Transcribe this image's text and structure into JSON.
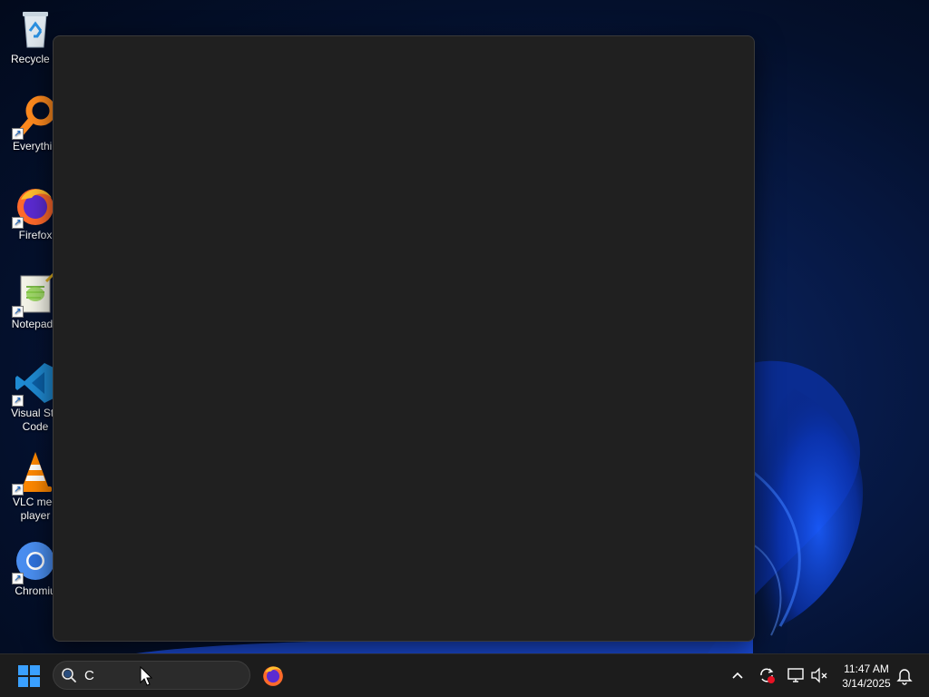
{
  "desktop": {
    "icons": [
      {
        "label": "Recycle B",
        "icon": "recycle-bin-icon"
      },
      {
        "label": "Everythin",
        "icon": "everything-search-icon"
      },
      {
        "label": "Firefox",
        "icon": "firefox-icon"
      },
      {
        "label": "Notepad+",
        "icon": "notepad-plus-plus-icon"
      },
      {
        "label": "Visual Stu\nCode",
        "icon": "vscode-icon"
      },
      {
        "label": "VLC med\nplayer",
        "icon": "vlc-icon"
      },
      {
        "label": "Chromiu",
        "icon": "chromium-icon"
      }
    ]
  },
  "taskbar": {
    "start_icon": "windows-start-icon",
    "search": {
      "value": "C",
      "icon": "search-icon"
    },
    "pinned": [
      {
        "name": "Firefox",
        "icon": "firefox-icon"
      }
    ],
    "tray": {
      "chevron_icon": "chevron-up-icon",
      "sync_icon": "sync-alert-icon",
      "network_icon": "network-icon",
      "volume_icon": "volume-muted-icon",
      "notification_icon": "notification-bell-icon"
    },
    "clock": {
      "time": "11:47 AM",
      "date": "3/14/2025"
    }
  },
  "colors": {
    "accent": "#0078d4",
    "panel": "#202020",
    "taskbar": "#1c1c1c"
  }
}
